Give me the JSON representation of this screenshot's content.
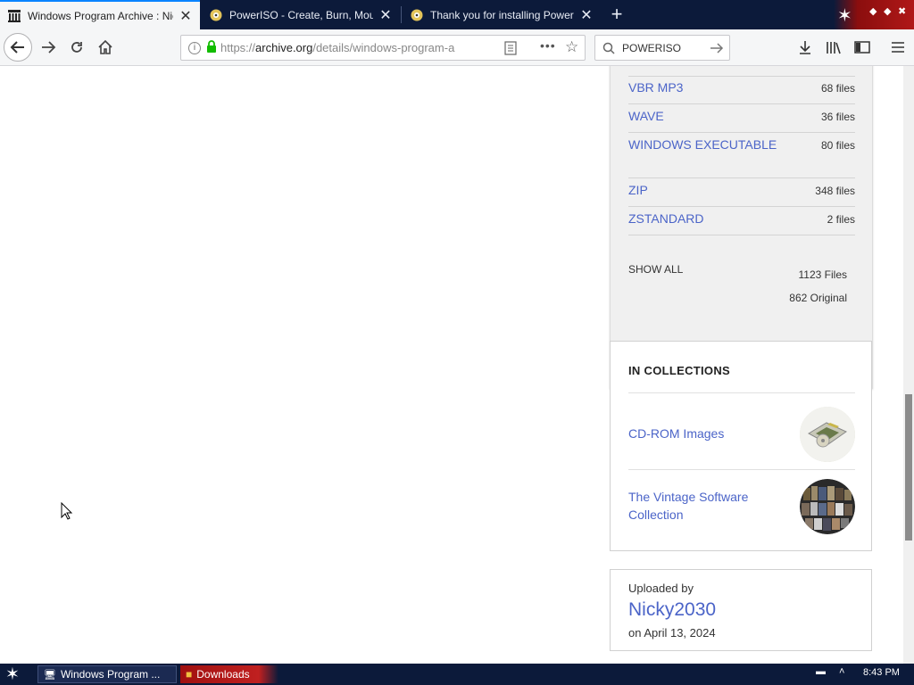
{
  "browser": {
    "tabs": [
      {
        "title": "Windows Program Archive : Nicho"
      },
      {
        "title": "PowerISO - Create, Burn, Mount,"
      },
      {
        "title": "Thank you for installing PowerISO!"
      }
    ],
    "url_prefix": "https://",
    "url_host": "archive.org",
    "url_path": "/details/windows-program-a",
    "search_text": "POWERISO"
  },
  "formats": {
    "items": [
      {
        "name": "VBR MP3",
        "count": "68 files"
      },
      {
        "name": "WAVE",
        "count": "36 files"
      },
      {
        "name": "WINDOWS EXECUTABLE",
        "count": "80 files"
      },
      {
        "name": "ZIP",
        "count": "348 files"
      },
      {
        "name": "ZSTANDARD",
        "count": "2 files"
      }
    ],
    "show_all": "SHOW ALL",
    "total_files": "1123 Files",
    "original_files": "862 Original"
  },
  "collections": {
    "heading": "IN COLLECTIONS",
    "items": [
      {
        "label": "CD-ROM Images"
      },
      {
        "label": "The Vintage Software Collection"
      }
    ]
  },
  "uploader": {
    "label": "Uploaded by",
    "name": "Nicky2030",
    "date": "on April 13, 2024"
  },
  "taskbar": {
    "items": [
      {
        "label": "Windows Program ..."
      },
      {
        "label": "Downloads"
      }
    ],
    "time": "8:43 PM"
  }
}
